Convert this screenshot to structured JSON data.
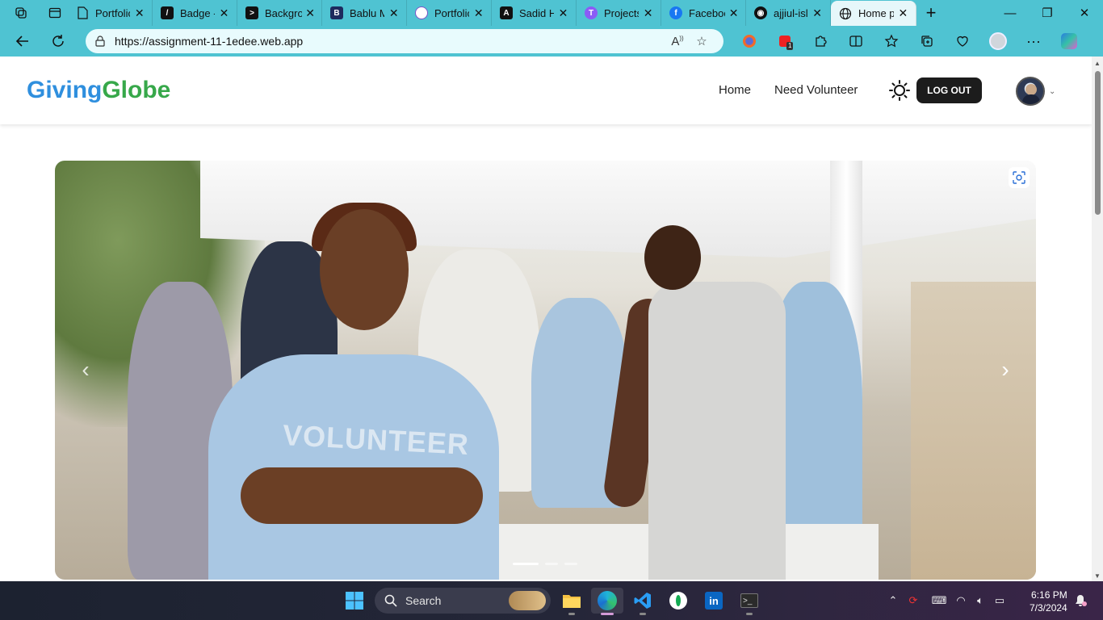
{
  "browser": {
    "tabs": [
      {
        "label": "Portfolio",
        "favicon": "document-icon"
      },
      {
        "label": "Badge - ",
        "favicon": "brand-slash-icon"
      },
      {
        "label": "Background",
        "favicon": "play-icon"
      },
      {
        "label": "Bablu M",
        "favicon": "b-icon"
      },
      {
        "label": "Portfolio",
        "favicon": "avatar-icon"
      },
      {
        "label": "Sadid H",
        "favicon": "a-icon"
      },
      {
        "label": "Projects",
        "favicon": "t-icon"
      },
      {
        "label": "Facebook",
        "favicon": "facebook-icon"
      },
      {
        "label": "ajjiul-isl",
        "favicon": "github-icon"
      },
      {
        "label": "Home p",
        "favicon": "globe-icon",
        "active": true
      }
    ],
    "url": "https://assignment-11-1edee.web.app",
    "extension_badge": "1"
  },
  "site": {
    "logo_part1": "Giving",
    "logo_part2": "Globe",
    "nav": {
      "home": "Home",
      "need_volunteer": "Need Volunteer",
      "logout": "LOG OUT"
    },
    "colors": {
      "logo_blue": "#2f8fde",
      "logo_green": "#37a84a",
      "logout_bg": "#1c1c1c"
    }
  },
  "hero": {
    "shirt_text": "VOLUNTEER",
    "slides_count": 3,
    "active_slide": 1
  },
  "taskbar": {
    "search_placeholder": "Search",
    "time": "6:16 PM",
    "date": "7/3/2024"
  }
}
